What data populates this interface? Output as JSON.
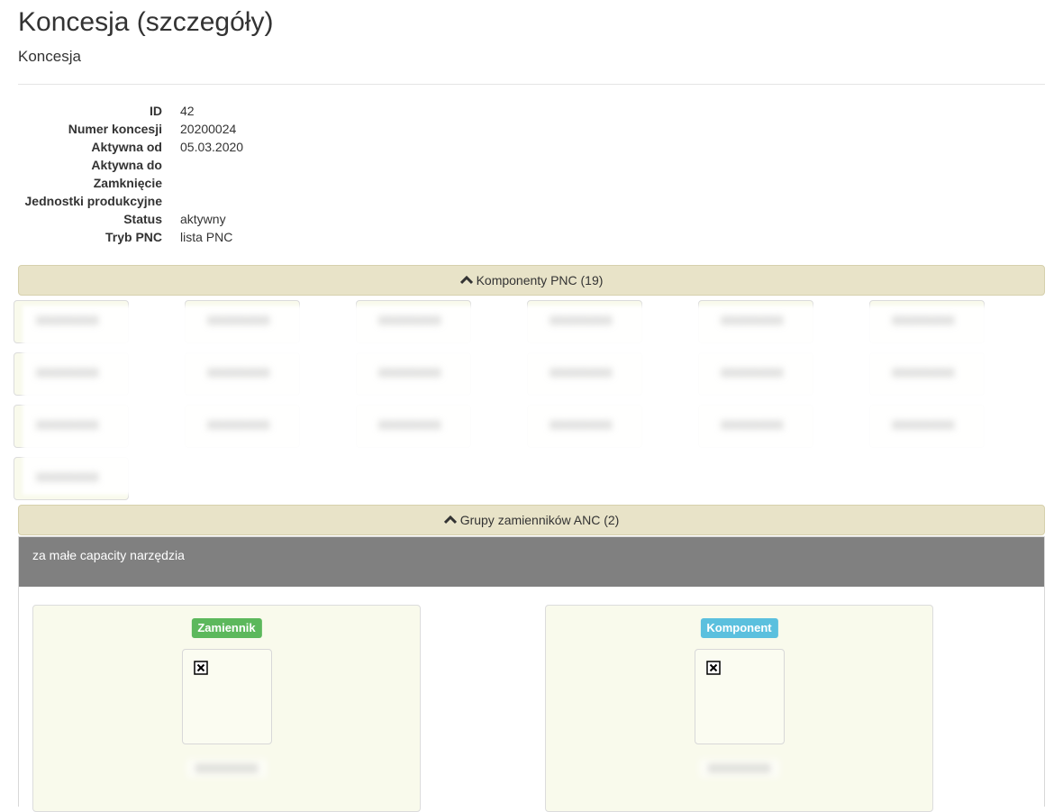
{
  "page": {
    "title": "Koncesja (szczegóły)",
    "subtitle": "Koncesja"
  },
  "details": [
    {
      "label": "ID",
      "value": "42"
    },
    {
      "label": "Numer koncesji",
      "value": "20200024"
    },
    {
      "label": "Aktywna od",
      "value": "05.03.2020"
    },
    {
      "label": "Aktywna do",
      "value": ""
    },
    {
      "label": "Zamknięcie",
      "value": ""
    },
    {
      "label": "Jednostki produkcyjne",
      "value": ""
    },
    {
      "label": "Status",
      "value": "aktywny"
    },
    {
      "label": "Tryb PNC",
      "value": "lista PNC"
    }
  ],
  "components_panel": {
    "label": "Komponenty PNC (19)",
    "icon": "chevron-up-icon",
    "items": [
      "XXXXXXXX",
      "XXXXXXXX",
      "XXXXXXXX",
      "XXXXXXXX",
      "XXXXXXXX",
      "XXXXXXXX",
      "XXXXXXXX",
      "XXXXXXXX",
      "XXXXXXXX",
      "XXXXXXXX",
      "XXXXXXXX",
      "XXXXXXXX",
      "XXXXXXXX",
      "XXXXXXXX",
      "XXXXXXXX",
      "XXXXXXXX",
      "XXXXXXXX",
      "XXXXXXXX",
      "XXXXXXXX"
    ]
  },
  "groups_panel": {
    "label": "Grupy zamienników ANC (2)",
    "icon": "chevron-up-icon"
  },
  "group": {
    "title": "za małe capacity narzędzia",
    "cards": [
      {
        "badge": "Zamiennik",
        "badge_color": "#5cb85c",
        "code": "XXXXXXXX"
      },
      {
        "badge": "Komponent",
        "badge_color": "#5bc0de",
        "code": "XXXXXXXX"
      }
    ]
  },
  "colors": {
    "panel_bar": "#e8e3c8",
    "cell_bg": "#f9faec",
    "group_header": "#808080"
  }
}
